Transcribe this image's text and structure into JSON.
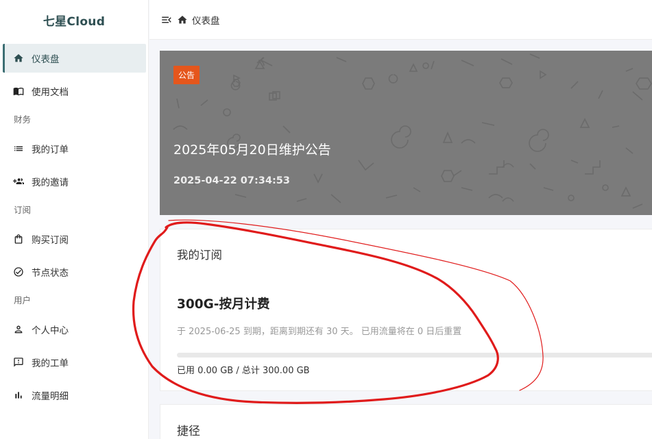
{
  "brand": {
    "name": "七星Cloud"
  },
  "sidebar": {
    "items": [
      {
        "label": "仪表盘",
        "icon": "home-icon",
        "active": true
      },
      {
        "label": "使用文档",
        "icon": "book-icon"
      }
    ],
    "sections": [
      {
        "label": "财务",
        "items": [
          {
            "label": "我的订单",
            "icon": "list-icon"
          },
          {
            "label": "我的邀请",
            "icon": "group-add-icon"
          }
        ]
      },
      {
        "label": "订阅",
        "items": [
          {
            "label": "购买订阅",
            "icon": "shopping-bag-icon"
          },
          {
            "label": "节点状态",
            "icon": "check-circle-icon"
          }
        ]
      },
      {
        "label": "用户",
        "items": [
          {
            "label": "个人中心",
            "icon": "person-icon"
          },
          {
            "label": "我的工单",
            "icon": "feedback-icon"
          },
          {
            "label": "流量明细",
            "icon": "bar-chart-icon"
          }
        ]
      }
    ]
  },
  "header": {
    "breadcrumb": "仪表盘"
  },
  "announcement": {
    "badge": "公告",
    "title": "2025年05月20日维护公告",
    "date": "2025-04-22 07:34:53"
  },
  "subscription": {
    "card_title": "我的订阅",
    "plan_name": "300G-按月计费",
    "description": "于 2025-06-25 到期，距离到期还有 30 天。 已用流量将在 0 日后重置",
    "usage": "已用 0.00 GB / 总计 300.00 GB",
    "used_fraction": 0.0
  },
  "shortcuts": {
    "card_title": "捷径"
  },
  "colors": {
    "accent": "#3c6e73",
    "badge": "#e5561c",
    "annotation": "#e01b1b"
  }
}
